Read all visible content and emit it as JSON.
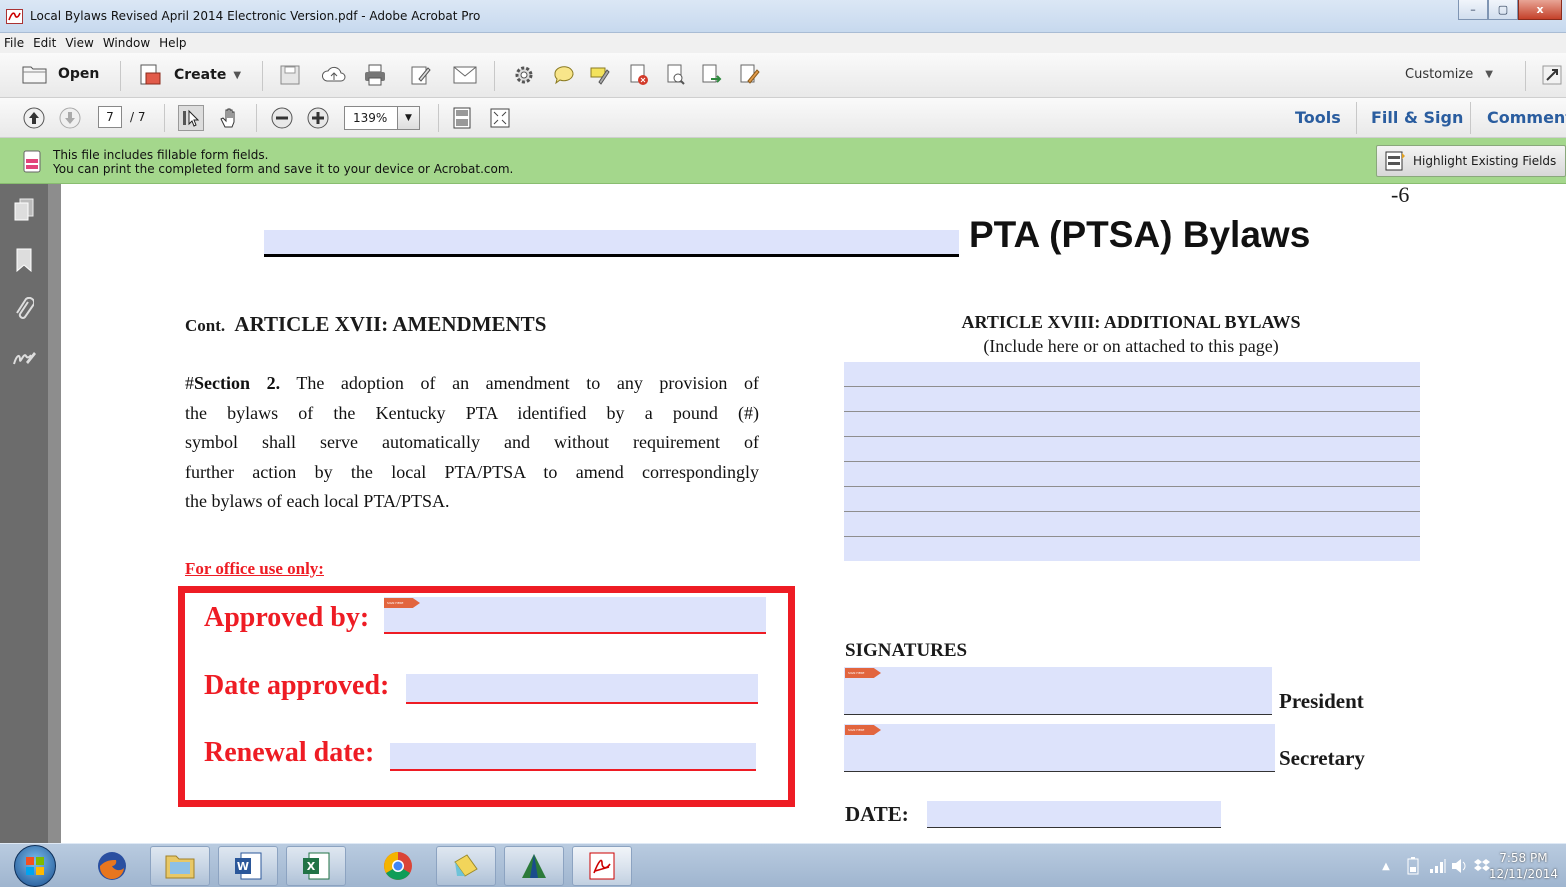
{
  "window": {
    "title": "Local Bylaws Revised April 2014 Electronic Version.pdf - Adobe Acrobat Pro",
    "minimize": "–",
    "maximize": "▢",
    "close": "x"
  },
  "menu": [
    "File",
    "Edit",
    "View",
    "Window",
    "Help"
  ],
  "toolbar": {
    "open_label": "Open",
    "create_label": "Create",
    "customize_label": "Customize"
  },
  "nav": {
    "page_current": "7",
    "page_total": "/ 7",
    "zoom": "139%",
    "tools_label": "Tools",
    "fillsign_label": "Fill & Sign",
    "comment_label": "Comment"
  },
  "notice": {
    "line1": "This file includes fillable form fields.",
    "line2": "You can print the completed form and save it to your device or Acrobat.com.",
    "highlight_button": "Highlight Existing Fields"
  },
  "document": {
    "page_marker": "-6",
    "header_title": "PTA (PTSA) Bylaws",
    "left": {
      "cont_prefix": "Cont.",
      "article_title": "ARTICLE XVII: AMENDMENTS",
      "section_prefix": "#",
      "section_label": "Section 2.",
      "line1": " The adoption of an amendment to any provision of",
      "line2": "the bylaws of the Kentucky PTA identified by a pound (#)",
      "line3": "symbol shall serve automatically and without requirement of",
      "line4": "further action by the local PTA/PTSA to amend correspondingly",
      "line5": "the bylaws of each local PTA/PTSA.",
      "office_use": "For office use only:",
      "approved_by": "Approved by:",
      "date_approved": "Date approved:",
      "renewal_date": "Renewal date:"
    },
    "right": {
      "article_title": "ARTICLE XVIII: ADDITIONAL BYLAWS",
      "article_sub": "(Include here or on attached to this page)",
      "signatures_heading": "SIGNATURES",
      "president": "President",
      "secretary": "Secretary",
      "date_label": "DATE:"
    },
    "sign_tag": "SIGN HERE"
  },
  "taskbar": {
    "time": "7:58 PM",
    "date": "12/11/2014"
  },
  "colors": {
    "form_field": "#dde3fb",
    "office_red": "#ee1c24",
    "notice_green": "#a4d78c",
    "link_blue": "#2a5d9f"
  }
}
